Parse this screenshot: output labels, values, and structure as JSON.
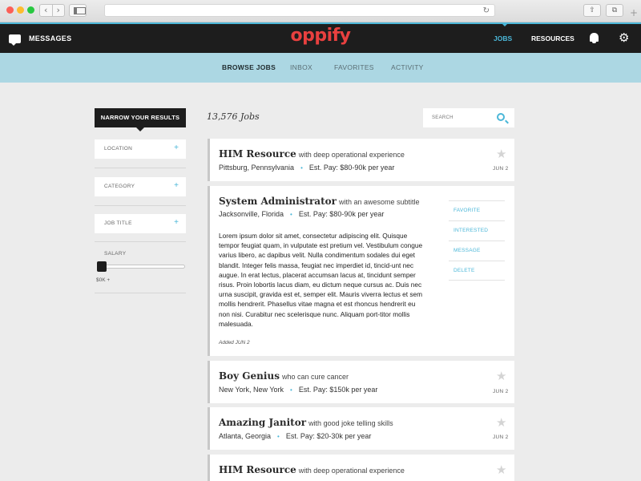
{
  "browser": {
    "back": "‹",
    "forward": "›",
    "reload": "↻",
    "share": "⇧",
    "tabs": "⧉",
    "new_tab": "+"
  },
  "header": {
    "messages_label": "MESSAGES",
    "logo": "oppify",
    "nav_jobs": "JOBS",
    "nav_resources": "RESOURCES",
    "settings_icon": "⚙"
  },
  "subnav": {
    "tabs": [
      {
        "label": "BROWSE JOBS",
        "active": true
      },
      {
        "label": "INBOX"
      },
      {
        "label": "FAVORITES"
      },
      {
        "label": "ACTIVITY"
      }
    ]
  },
  "filters": {
    "heading": "NARROW YOUR RESULTS",
    "location": "LOCATION",
    "category": "CATEGORY",
    "job_title": "JOB TITLE",
    "plus": "+",
    "salary_label": "SALARY",
    "salary_value": "$0K +",
    "salary_level": 0
  },
  "main": {
    "job_count": "13,576 Jobs",
    "search_placeholder": "SEARCH"
  },
  "jobs": [
    {
      "title": "HIM Resource",
      "subtitle": "with deep operational experience",
      "location": "Pittsburg, Pennsylvania",
      "pay": "Est. Pay: $80-90k per year",
      "date": "JUN 2",
      "star": "★"
    },
    {
      "title": "System Administrator",
      "subtitle": "with an awesome subtitle",
      "location": "Jacksonville, Florida",
      "pay": "Est. Pay: $80-90k per year",
      "body": "Lorem ipsum dolor sit amet, consectetur adipiscing elit. Quisque tempor feugiat quam, in vulputate est pretium vel. Vestibulum congue varius libero, ac dapibus velit. Nulla condimentum sodales dui eget blandit. Integer felis massa, feugiat nec imperdiet id, tincid-unt nec augue. In erat lectus, placerat accumsan lacus at, tincidunt semper risus. Proin lobortis lacus diam, eu dictum neque cursus ac. Duis nec urna suscipit, gravida est et, semper elit. Mauris viverra lectus et sem mollis hendrerit. Phasellus vitae magna et est rhoncus hendrerit eu non nisi. Curabitur nec scelerisque nunc. Aliquam port-titor mollis malesuada.",
      "added": "Added JUN 2",
      "actions": [
        "FAVORITE",
        "INTERESTED",
        "MESSAGE",
        "DELETE"
      ]
    },
    {
      "title": "Boy Genius",
      "subtitle": "who can cure cancer",
      "location": "New York, New York",
      "pay": "Est. Pay: $150k per year",
      "date": "JUN 2",
      "star": "★"
    },
    {
      "title": "Amazing Janitor",
      "subtitle": "with good joke telling skills",
      "location": "Atlanta, Georgia",
      "pay": "Est. Pay: $20-30k per year",
      "date": "JUN 2",
      "star": "★"
    },
    {
      "title": "HIM Resource",
      "subtitle": "with deep operational experience",
      "star": "★"
    }
  ],
  "bullet": "•"
}
